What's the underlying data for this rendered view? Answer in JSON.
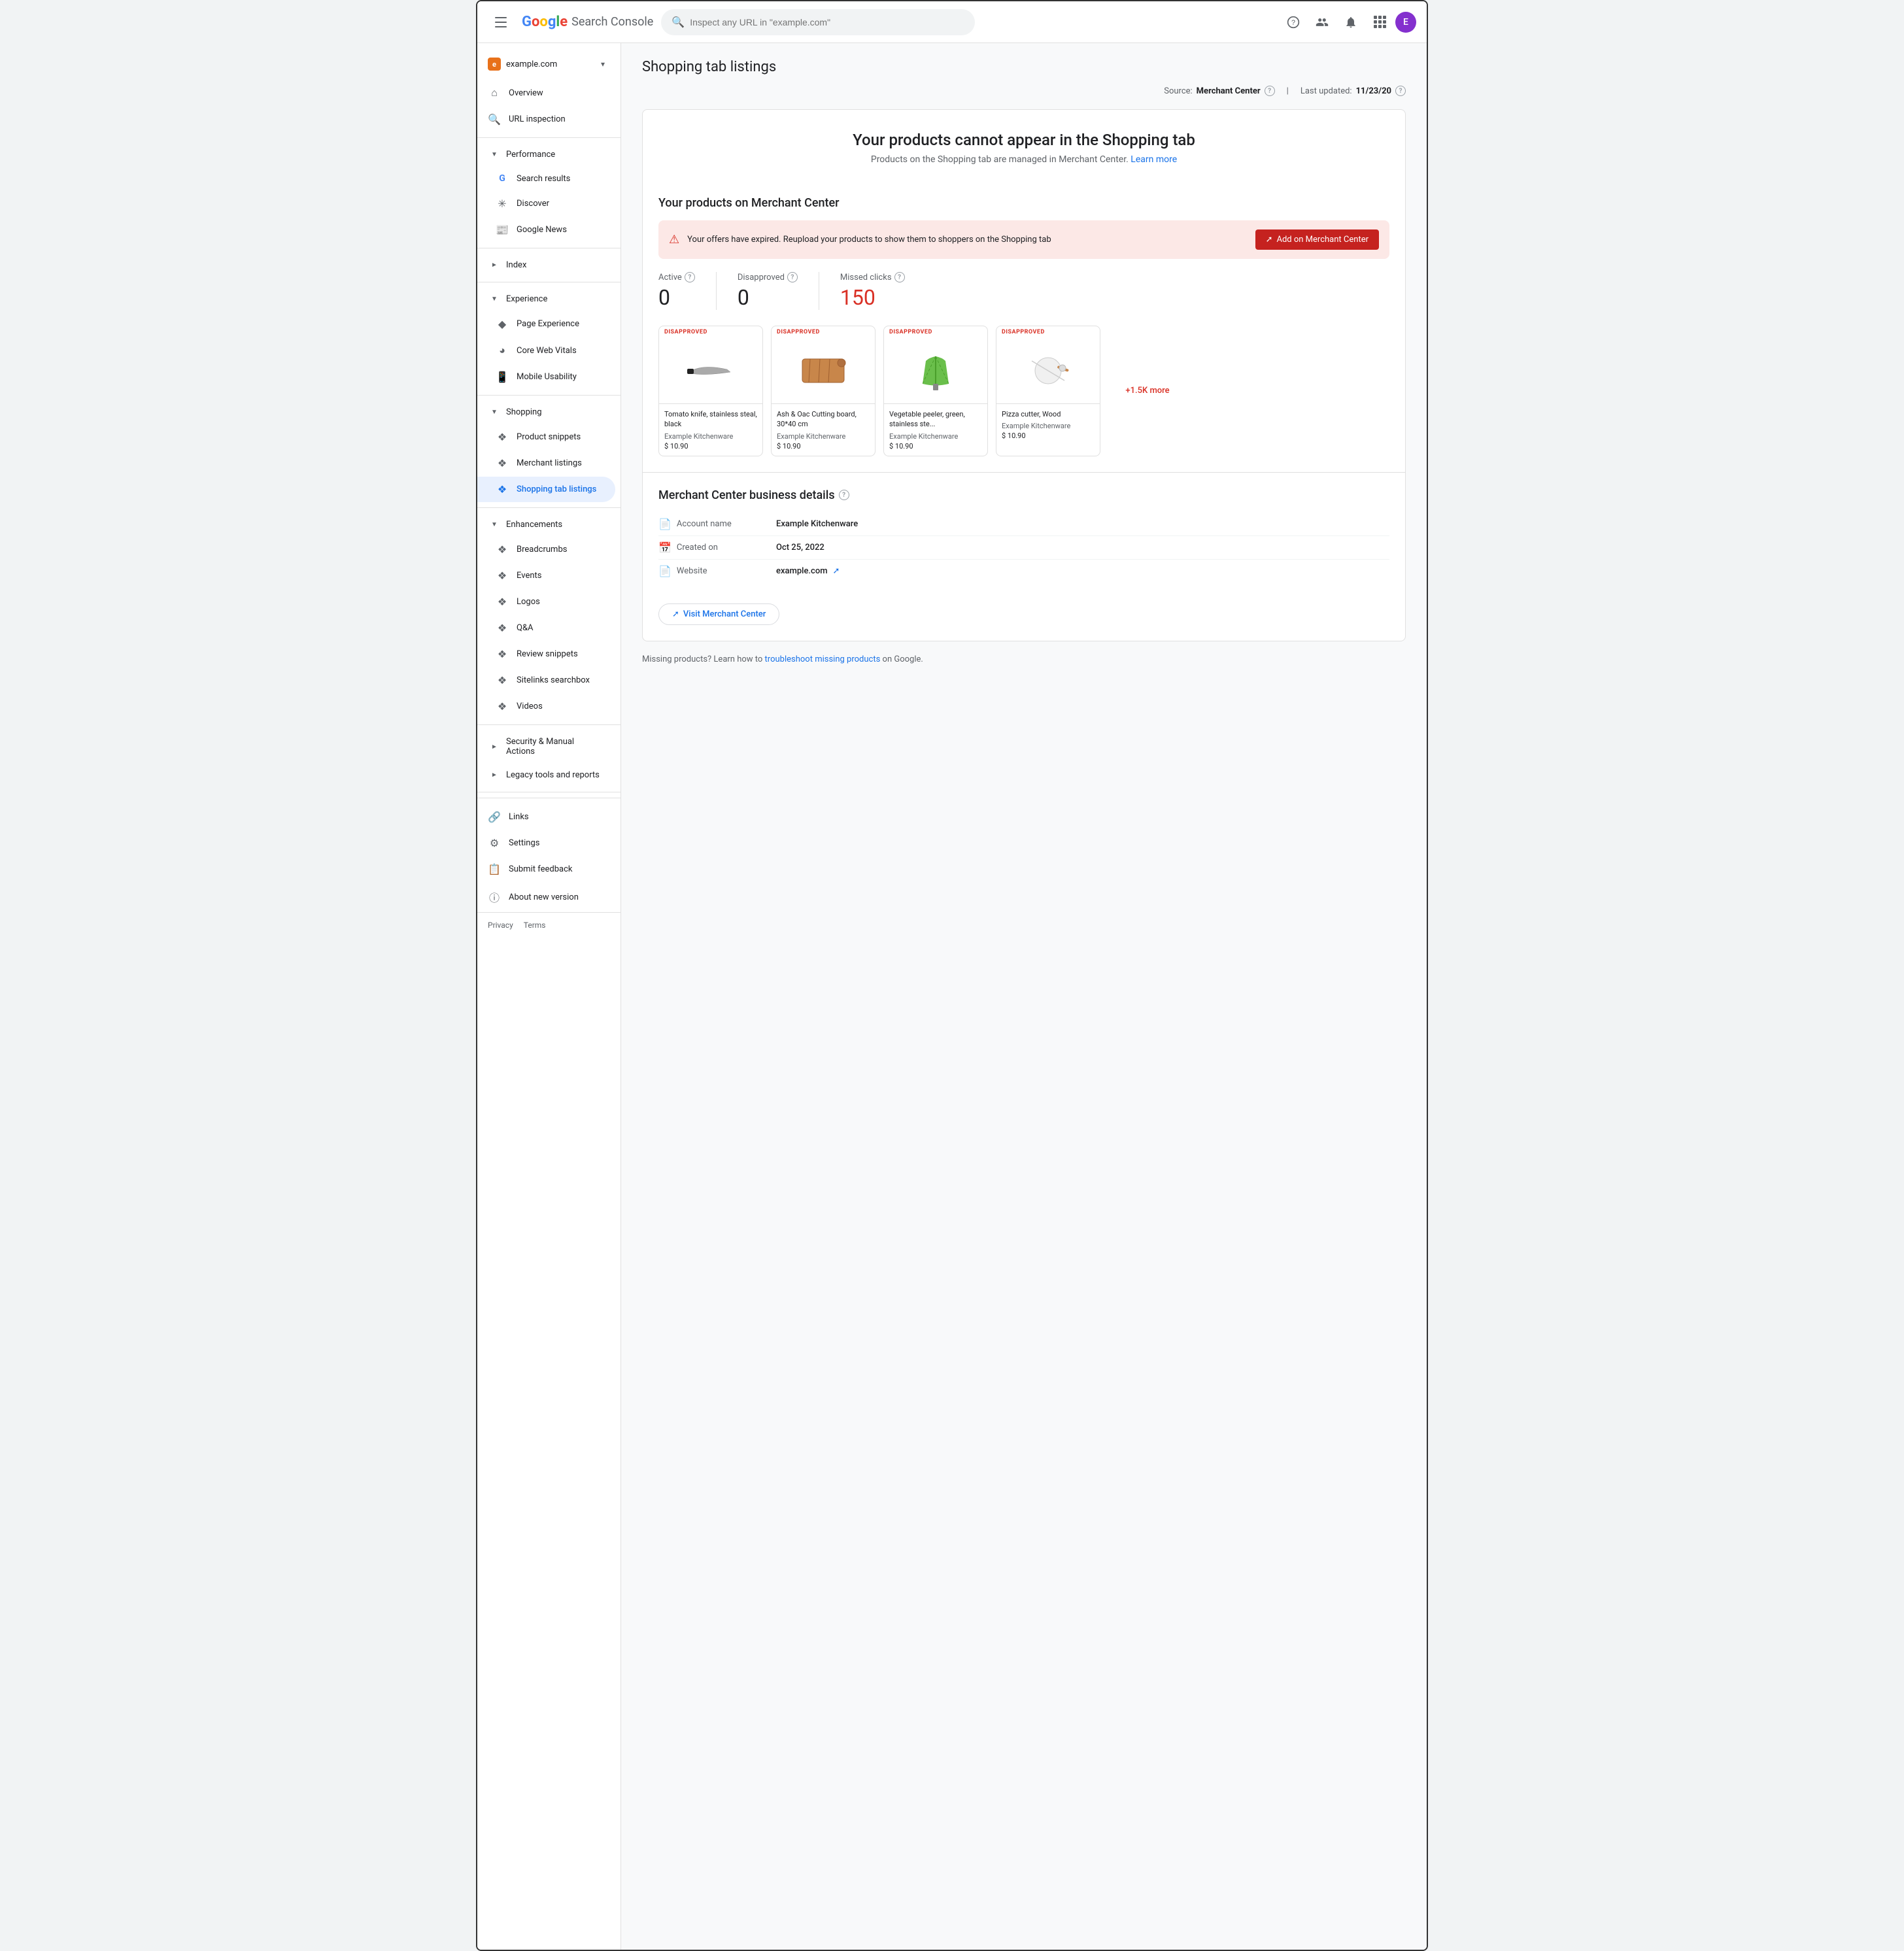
{
  "app": {
    "title": "Google Search Console",
    "logo_letters": [
      "G",
      "o",
      "o",
      "g",
      "l",
      "e"
    ],
    "search_placeholder": "Inspect any URL in \"example.com\"",
    "avatar_letter": "E"
  },
  "site": {
    "name": "example.com",
    "favicon_letter": "e"
  },
  "sidebar": {
    "overview_label": "Overview",
    "url_inspection_label": "URL inspection",
    "performance_section": "Performance",
    "search_results_label": "Search results",
    "discover_label": "Discover",
    "google_news_label": "Google News",
    "index_section": "Index",
    "experience_section": "Experience",
    "page_experience_label": "Page Experience",
    "core_web_vitals_label": "Core Web Vitals",
    "mobile_usability_label": "Mobile Usability",
    "shopping_section": "Shopping",
    "product_snippets_label": "Product snippets",
    "merchant_listings_label": "Merchant listings",
    "shopping_tab_listings_label": "Shopping tab listings",
    "enhancements_section": "Enhancements",
    "breadcrumbs_label": "Breadcrumbs",
    "events_label": "Events",
    "logos_label": "Logos",
    "qa_label": "Q&A",
    "review_snippets_label": "Review snippets",
    "sitelinks_searchbox_label": "Sitelinks searchbox",
    "videos_label": "Videos",
    "security_section": "Security & Manual Actions",
    "legacy_section": "Legacy tools and reports",
    "links_label": "Links",
    "settings_label": "Settings",
    "submit_feedback_label": "Submit feedback",
    "about_new_version_label": "About new version",
    "privacy_label": "Privacy",
    "terms_label": "Terms"
  },
  "page": {
    "title": "Shopping tab listings",
    "source_label": "Source:",
    "source_value": "Merchant Center",
    "last_updated_label": "Last updated:",
    "last_updated_value": "11/23/20"
  },
  "hero": {
    "title": "Your products cannot appear in the Shopping tab",
    "subtitle": "Products on the Shopping tab are managed in Merchant Center.",
    "learn_more": "Learn more"
  },
  "products_section": {
    "title": "Your products on Merchant Center",
    "alert_text": "Your offers have expired. Reupload your products to show them to shoppers on the Shopping tab",
    "add_btn_label": "Add on Merchant Center",
    "active_label": "Active",
    "disapproved_label": "Disapproved",
    "missed_clicks_label": "Missed clicks",
    "active_value": "0",
    "disapproved_value": "0",
    "missed_clicks_value": "150",
    "more_label": "+1.5K more",
    "products": [
      {
        "badge": "DISAPPROVED",
        "name": "Tomato knife, stainless steal, black",
        "brand": "Example Kitchenware",
        "price": "$ 10.90",
        "emoji": "🔪"
      },
      {
        "badge": "DISAPPROVED",
        "name": "Ash & Oac Cutting board, 30*40 cm",
        "brand": "Example Kitchenware",
        "price": "$ 10.90",
        "emoji": "🪵"
      },
      {
        "badge": "DISAPPROVED",
        "name": "Vegetable peeler, green, stainless ste...",
        "brand": "Example Kitchenware",
        "price": "$ 10.90",
        "emoji": "🥬"
      },
      {
        "badge": "DISAPPROVED",
        "name": "Pizza cutter, Wood",
        "brand": "Example Kitchenware",
        "price": "$ 10.90",
        "emoji": "🍕"
      }
    ]
  },
  "business": {
    "title": "Merchant Center business details",
    "account_name_label": "Account name",
    "account_name_value": "Example Kitchenware",
    "created_on_label": "Created on",
    "created_on_value": "Oct 25, 2022",
    "website_label": "Website",
    "website_value": "example.com",
    "visit_btn_label": "Visit Merchant Center"
  },
  "footer": {
    "note": "Missing products? Learn how to",
    "link_text": "troubleshoot missing products",
    "note_suffix": "on Google."
  }
}
